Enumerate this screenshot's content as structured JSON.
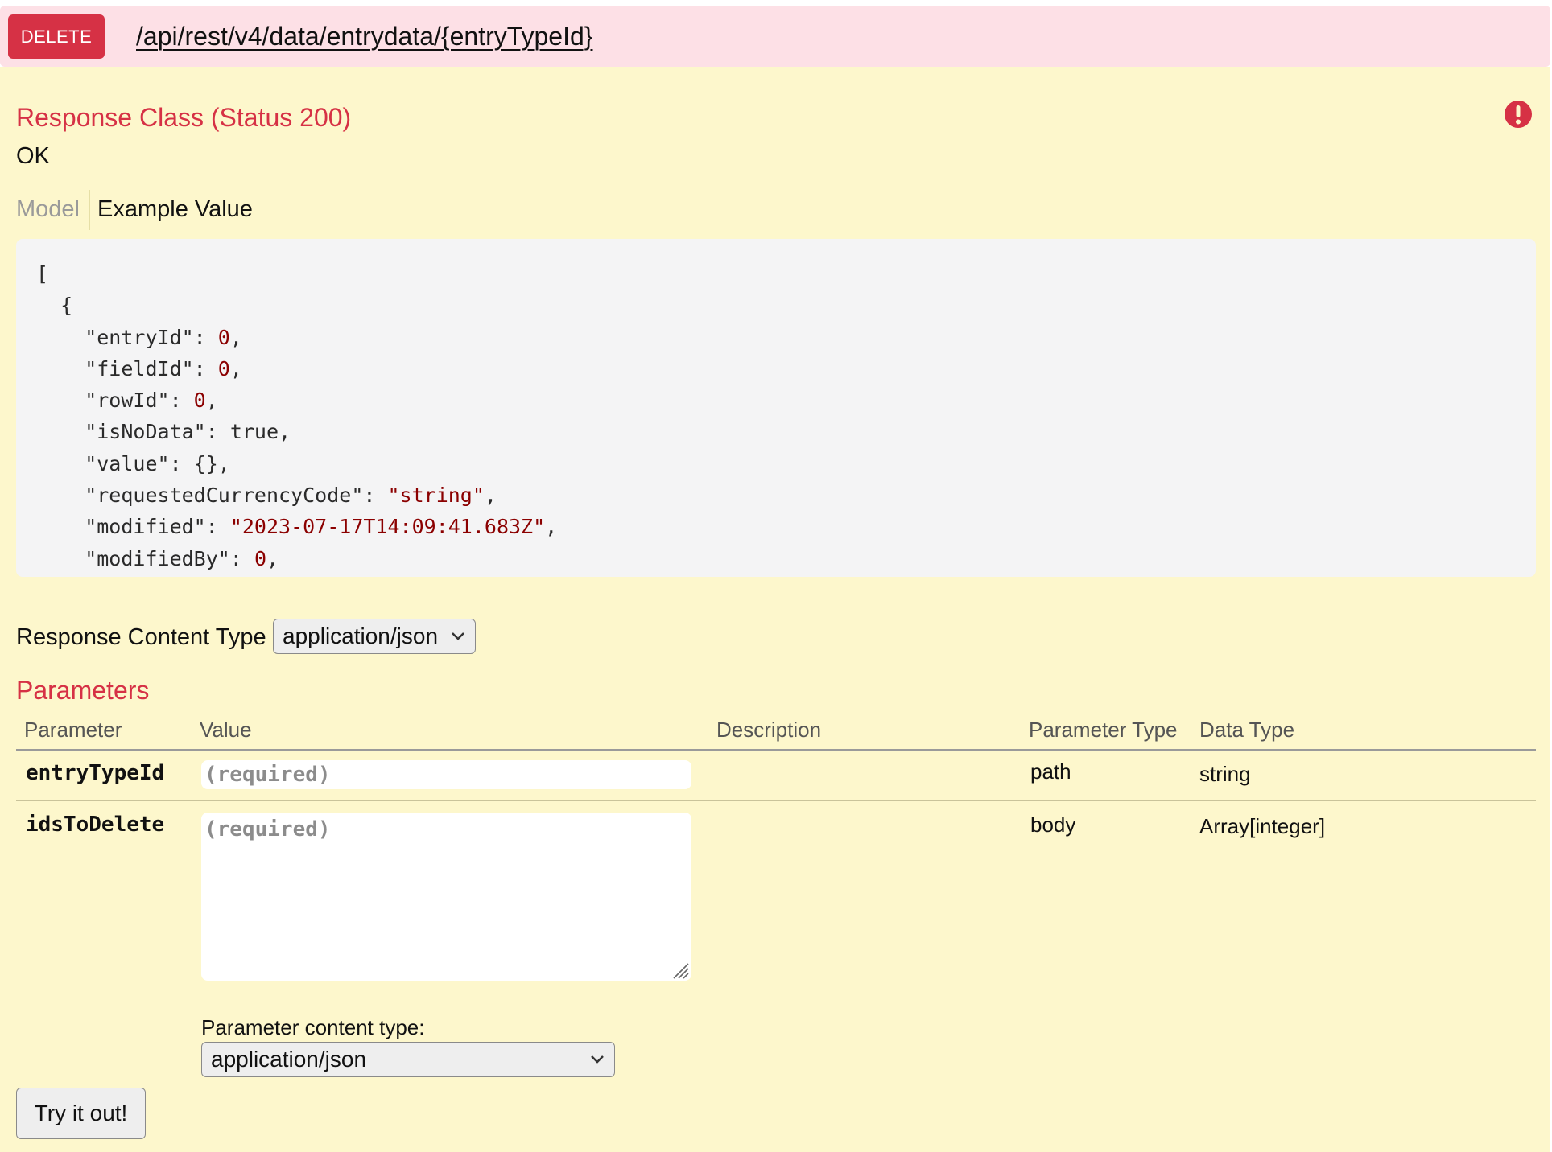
{
  "endpoint": {
    "method": "DELETE",
    "path": "/api/rest/v4/data/entrydata/{entryTypeId}"
  },
  "response": {
    "title": "Response Class (Status 200)",
    "message": "OK",
    "tabs": {
      "model": "Model",
      "example": "Example Value"
    },
    "example_lines": [
      "[",
      "  {",
      "    \"entryId\": 0,",
      "    \"fieldId\": 0,",
      "    \"rowId\": 0,",
      "    \"isNoData\": true,",
      "    \"value\": {},",
      "    \"requestedCurrencyCode\": \"string\",",
      "    \"modified\": \"2023-07-17T14:09:41.683Z\",",
      "    \"modifiedBy\": 0,"
    ],
    "content_type_label": "Response Content Type",
    "content_type_value": "application/json"
  },
  "parameters": {
    "title": "Parameters",
    "headers": [
      "Parameter",
      "Value",
      "Description",
      "Parameter Type",
      "Data Type"
    ],
    "rows": [
      {
        "name": "entryTypeId",
        "placeholder": "(required)",
        "description": "",
        "param_type": "path",
        "data_type": "string"
      },
      {
        "name": "idsToDelete",
        "placeholder": "(required)",
        "description": "",
        "param_type": "body",
        "data_type": "Array[integer]"
      }
    ],
    "content_type_label": "Parameter content type:",
    "content_type_value": "application/json"
  },
  "actions": {
    "try_label": "Try it out!"
  },
  "colors": {
    "method_bg": "#d63145",
    "header_bg": "#fde0e6",
    "panel_bg": "#fdf7cc",
    "accent": "#d63145"
  }
}
